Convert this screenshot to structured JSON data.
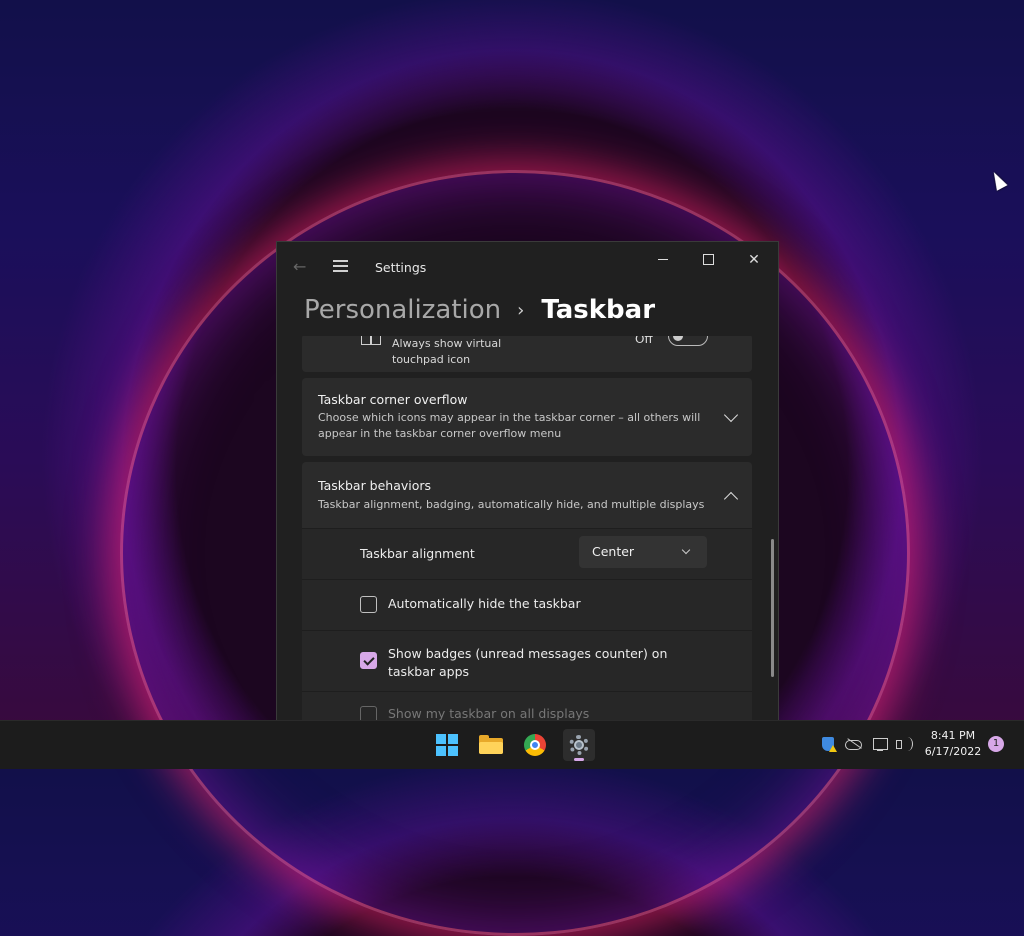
{
  "window": {
    "title": "Settings",
    "breadcrumb": {
      "parent": "Personalization",
      "separator": "›",
      "current": "Taskbar"
    }
  },
  "settings": {
    "touchpad": {
      "label": "Always show virtual touchpad icon",
      "state_label": "Off",
      "enabled": false
    },
    "corner_overflow": {
      "title": "Taskbar corner overflow",
      "description": "Choose which icons may appear in the taskbar corner – all others will appear in the taskbar corner overflow menu",
      "expanded": false
    },
    "behaviors": {
      "title": "Taskbar behaviors",
      "description": "Taskbar alignment, badging, automatically hide, and multiple displays",
      "expanded": true,
      "alignment": {
        "label": "Taskbar alignment",
        "value": "Center"
      },
      "auto_hide": {
        "label": "Automatically hide the taskbar",
        "checked": false
      },
      "badges": {
        "label": "Show badges (unread messages counter) on taskbar apps",
        "checked": true
      },
      "all_displays": {
        "label": "Show my taskbar on all displays",
        "checked": false,
        "disabled": true
      }
    }
  },
  "taskbar": {
    "apps": [
      "start-icon",
      "file-explorer-icon",
      "chrome-icon",
      "settings-icon"
    ],
    "active_app": "settings-icon",
    "tray": [
      "security-warning-icon",
      "onedrive-offline-icon",
      "network-icon",
      "volume-icon"
    ],
    "time": "8:41 PM",
    "date": "6/17/2022",
    "notification_count": "1"
  },
  "colors": {
    "accent": "#d7a8e8",
    "window_bg": "#202020",
    "card_bg": "#2b2b2b"
  }
}
